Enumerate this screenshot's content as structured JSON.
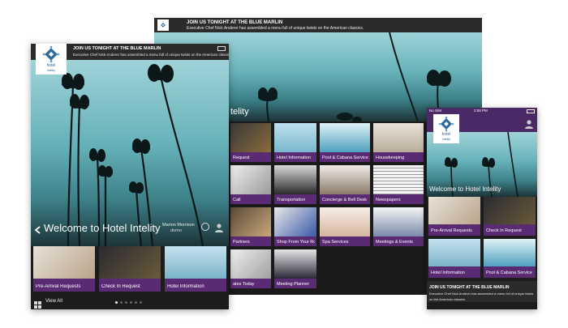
{
  "promo": {
    "headline": "JOIN US TONIGHT AT THE BLUE MARLIN",
    "body": "Executive Chef Nick Anderer has assembled a menu full of unique twists on the American classics."
  },
  "brand": {
    "logo_text": "hotel",
    "logo_sub": "intelity"
  },
  "welcome": "Welcome to Hotel Intelity",
  "welcome_partial": "telity",
  "guest": {
    "name": "Marion Morrison",
    "room": "domo"
  },
  "left_tiles": [
    "Pre-Arrival Requests",
    "Check In Request",
    "Hotel Information"
  ],
  "view_all": "View All",
  "mid_tiles_row1": [
    "Request",
    "Hotel Information",
    "Pool & Cabana Service",
    "Housekeeping"
  ],
  "mid_tiles_row2": [
    "Call",
    "Transportation",
    "Concierge & Bell Desk",
    "Newspapers"
  ],
  "mid_tiles_row3": [
    "Partners",
    "Shop From Your Room",
    "Spa Services",
    "Meetings & Events"
  ],
  "mid_tiles_row4": [
    "ates Today",
    "Meeting Planner"
  ],
  "phone": {
    "carrier": "No SIM",
    "time": "2:58 PM",
    "tiles": [
      "Pre-Arrival Requests",
      "Check In Request",
      "Hotel Information",
      "Pool & Cabana Service"
    ]
  },
  "colors": {
    "accent_purple": "#5a2b73",
    "promo_bg": "#2b2b2b",
    "dark_bg": "#1c1c1c"
  }
}
